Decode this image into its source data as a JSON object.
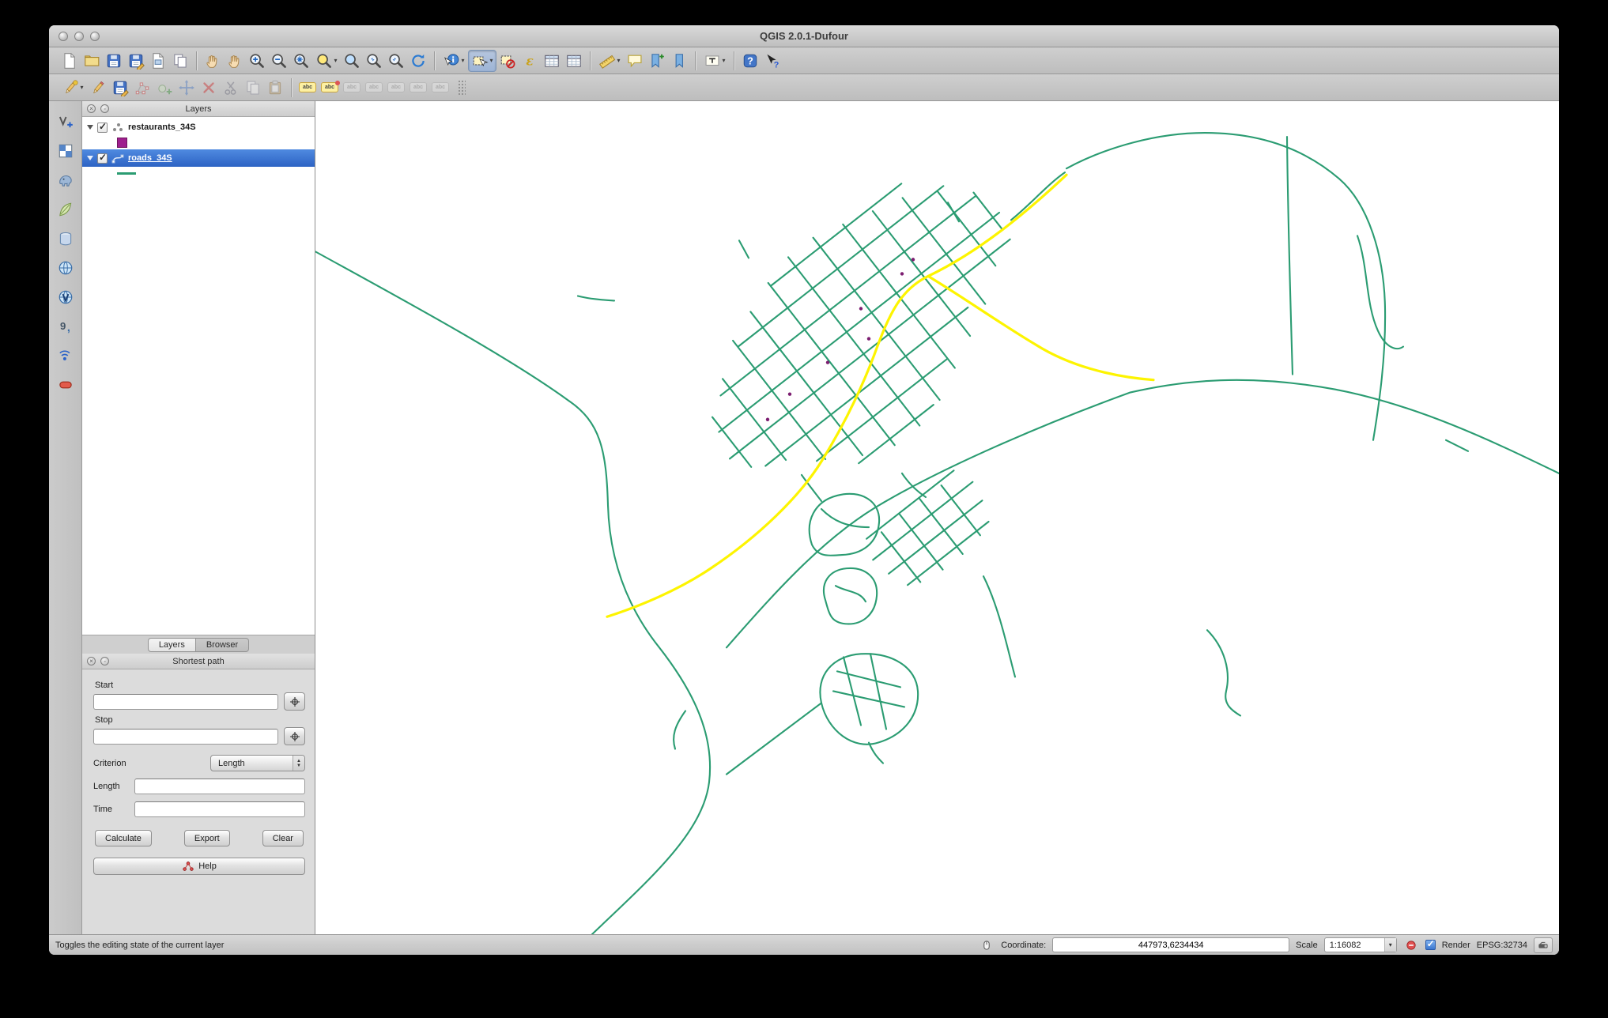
{
  "colors": {
    "road_green": "#2B9C72",
    "route_yellow": "#FDF400",
    "selection_blue": "#4F8AE0",
    "restaurants_magenta": "#9E1F8E"
  },
  "titlebar": {
    "title": "QGIS 2.0.1-Dufour"
  },
  "toolbars": {
    "main_icons": [
      "new-project",
      "open-project",
      "save-project",
      "save-project-as",
      "new-print-composer",
      "composer-manager",
      "pan-map",
      "pan-to-selection",
      "zoom-in",
      "zoom-out",
      "zoom-full-extent",
      "zoom-to-selection",
      "zoom-to-layer",
      "zoom-last",
      "zoom-next",
      "refresh-map",
      "identify-features",
      "select-features",
      "deselect-all",
      "select-by-expression",
      "open-attribute-table",
      "field-calculator",
      "measure-line",
      "map-tips",
      "new-bookmark",
      "show-bookmarks",
      "text-annotation",
      "help-contents",
      "whats-this"
    ],
    "edit_icons": [
      "current-edits",
      "toggle-editing",
      "save-layer-edits",
      "node-tool",
      "add-feature",
      "move-feature",
      "delete-selected",
      "cut-features",
      "copy-features",
      "paste-features",
      "labeling-options",
      "pin-labels",
      "highlight-pinned-labels",
      "move-label",
      "rotate-label",
      "change-label-properties",
      "show-hidden-labels"
    ],
    "left_icons": [
      "add-vector-layer",
      "add-raster-layer",
      "add-postgis-layer",
      "add-spatialite-layer",
      "add-mssql-layer",
      "add-wms-layer",
      "add-wfs-layer",
      "add-delimited-text-layer",
      "add-gps-layer",
      "add-oracle-layer"
    ],
    "label_icon_text": "abc"
  },
  "layers_panel": {
    "title": "Layers",
    "layers": [
      {
        "name": "restaurants_34S",
        "checked": true,
        "swatch_color": "#9E1F8E"
      },
      {
        "name": "roads_34S",
        "checked": true,
        "selected": true,
        "swatch_color": "#2B9C72"
      }
    ],
    "tabs": [
      "Layers",
      "Browser"
    ]
  },
  "shortest_path": {
    "title": "Shortest path",
    "start_label": "Start",
    "start_value": "",
    "stop_label": "Stop",
    "stop_value": "",
    "criterion_label": "Criterion",
    "criterion_value": "Length",
    "length_label": "Length",
    "length_value": "",
    "time_label": "Time",
    "time_value": "",
    "calculate_label": "Calculate",
    "export_label": "Export",
    "clear_label": "Clear",
    "help_label": "Help"
  },
  "status_bar": {
    "hint": "Toggles the editing state of the current layer",
    "coordinate_label": "Coordinate:",
    "coordinate_value": "447973,6234434",
    "scale_label": "Scale",
    "scale_value": "1:16082",
    "render_label": "Render",
    "render_checked": true,
    "crs_label": "EPSG:32734",
    "status_icons": [
      "mouse-position",
      "stop-rendering",
      "crs-status"
    ]
  }
}
